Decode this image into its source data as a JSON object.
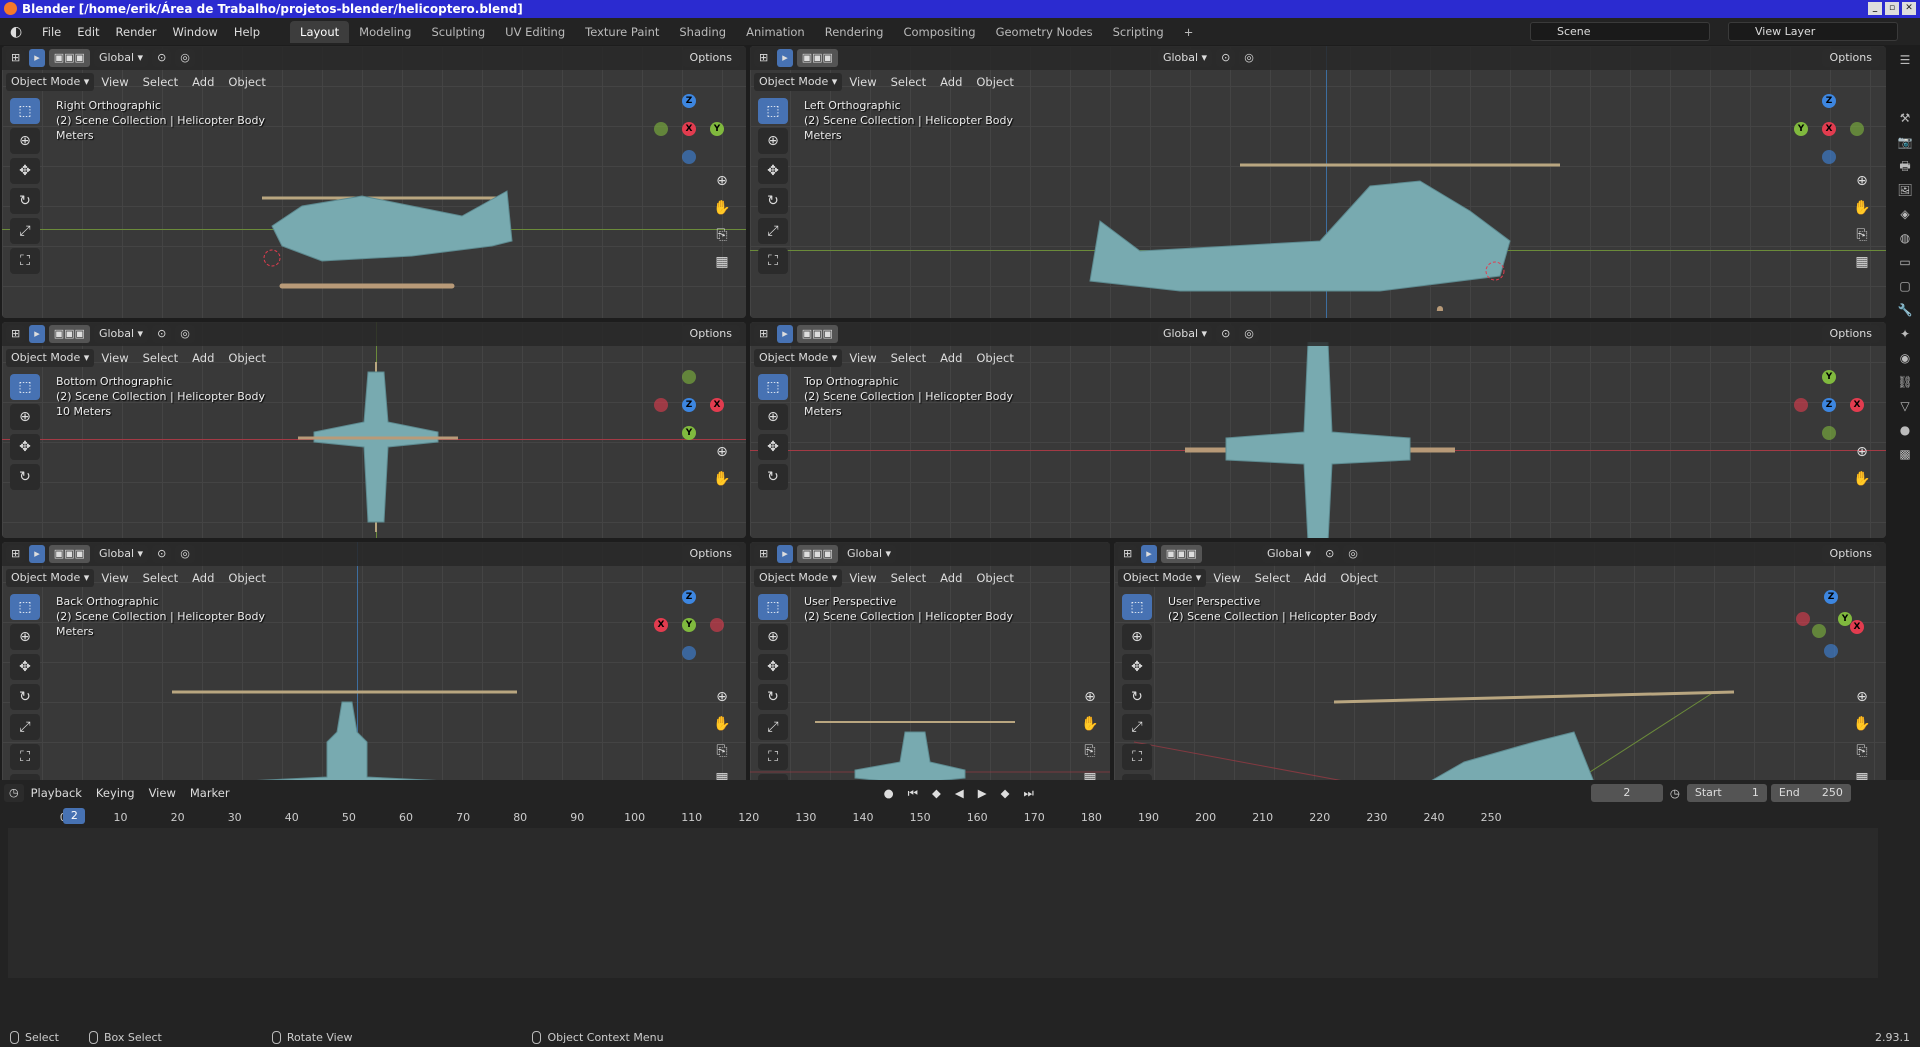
{
  "window": {
    "title": "Blender [/home/erik/Área de Trabalho/projetos-blender/helicoptero.blend]"
  },
  "menu": [
    "File",
    "Edit",
    "Render",
    "Window",
    "Help"
  ],
  "workspaces": [
    "Layout",
    "Modeling",
    "Sculpting",
    "UV Editing",
    "Texture Paint",
    "Shading",
    "Animation",
    "Rendering",
    "Compositing",
    "Geometry Nodes",
    "Scripting"
  ],
  "scene": {
    "name": "Scene",
    "view_layer": "View Layer"
  },
  "header": {
    "global": "Global",
    "options": "Options",
    "mode": "Object Mode",
    "view": "View",
    "select": "Select",
    "add": "Add",
    "object": "Object"
  },
  "viewports": [
    {
      "view": "Right Orthographic",
      "collection": "(2) Scene Collection | Helicopter Body",
      "units": "Meters"
    },
    {
      "view": "Left Orthographic",
      "collection": "(2) Scene Collection | Helicopter Body",
      "units": "Meters"
    },
    {
      "view": "Bottom Orthographic",
      "collection": "(2) Scene Collection | Helicopter Body",
      "units": "10 Meters"
    },
    {
      "view": "Top Orthographic",
      "collection": "(2) Scene Collection | Helicopter Body",
      "units": "Meters"
    },
    {
      "view": "Back Orthographic",
      "collection": "(2) Scene Collection | Helicopter Body",
      "units": "Meters"
    },
    {
      "view": "User Perspective",
      "collection": "(2) Scene Collection | Helicopter Body",
      "units": ""
    },
    {
      "view": "User Perspective",
      "collection": "(2) Scene Collection | Helicopter Body",
      "units": ""
    }
  ],
  "gizmo": {
    "x": "X",
    "y": "Y",
    "z": "Z"
  },
  "timeline": {
    "menus": [
      "Playback",
      "Keying",
      "View",
      "Marker"
    ],
    "current_frame": "2",
    "start_label": "Start",
    "start": "1",
    "end_label": "End",
    "end": "250",
    "ticks": [
      "0",
      "10",
      "20",
      "30",
      "40",
      "50",
      "60",
      "70",
      "80",
      "90",
      "100",
      "110",
      "120",
      "130",
      "140",
      "150",
      "160",
      "170",
      "180",
      "190",
      "200",
      "210",
      "220",
      "230",
      "240",
      "250"
    ]
  },
  "status": {
    "select": "Select",
    "box_select": "Box Select",
    "rotate": "Rotate View",
    "context": "Object Context Menu",
    "version": "2.93.1"
  },
  "colors": {
    "accent": "#4772b3",
    "axis_x": "#e23c4f",
    "axis_y": "#80b93e",
    "axis_z": "#3d86e0",
    "heli_body": "#78aab0",
    "heli_skid": "#b89a78"
  }
}
